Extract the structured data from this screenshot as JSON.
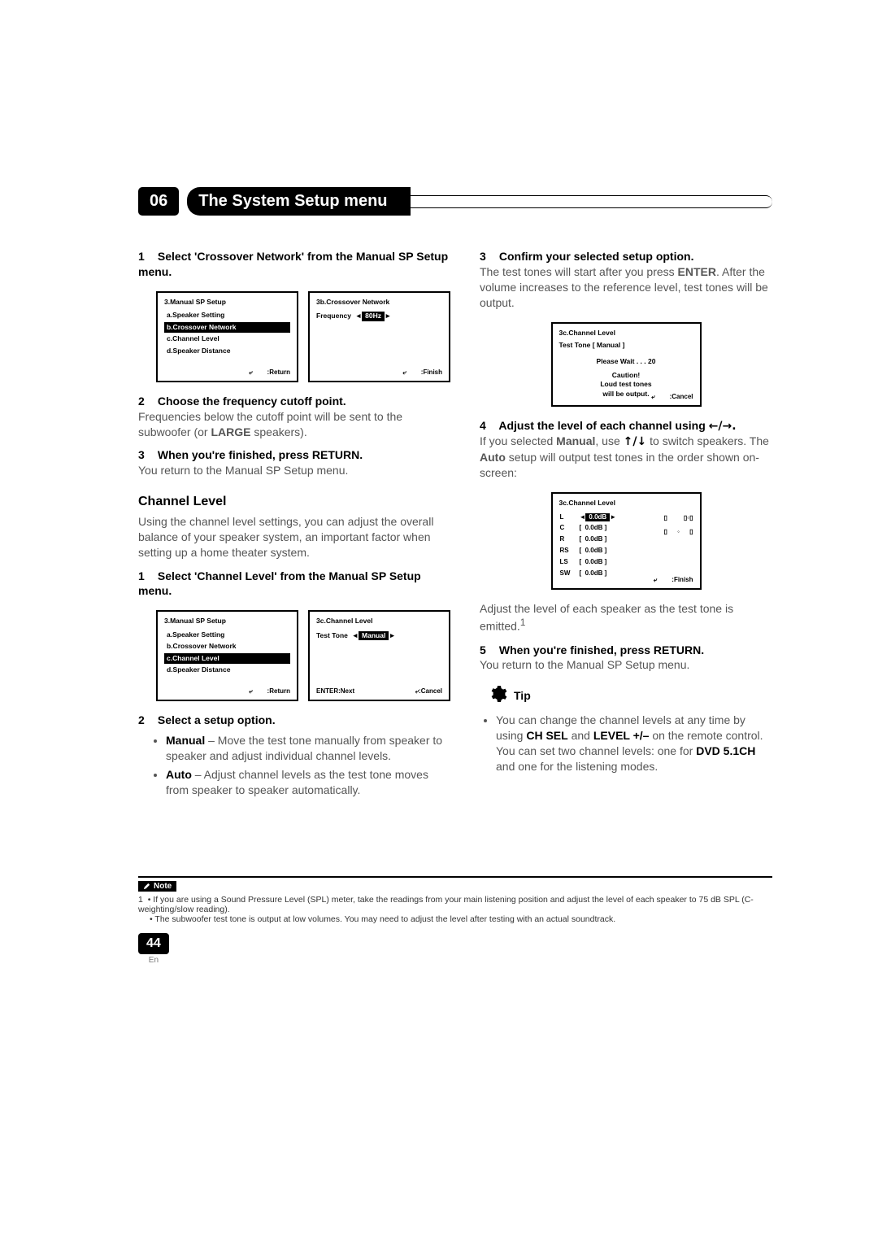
{
  "chapter": {
    "number": "06",
    "title": "The System Setup menu"
  },
  "col_left": {
    "step1": {
      "num": "1",
      "title": "Select 'Crossover Network' from the Manual SP Setup menu."
    },
    "screen_a": {
      "title": "3.Manual  SP   Setup",
      "items": [
        "a.Speaker   Setting",
        "b.Crossover   Network",
        "c.Channel   Level",
        "d.Speaker   Distance"
      ],
      "selected_index": 1,
      "footer_right": ":Return"
    },
    "screen_b": {
      "title": "3b.Crossover   Network",
      "label": "Frequency",
      "value": "80Hz",
      "footer_right": ":Finish"
    },
    "step2": {
      "num": "2",
      "title": "Choose the frequency cutoff point.",
      "body": "Frequencies below the cutoff point will be sent to the subwoofer (or ",
      "bold1": "LARGE",
      "body2": " speakers)."
    },
    "step3": {
      "num": "3",
      "title": "When you're finished, press RETURN.",
      "body": "You return to the Manual SP Setup menu."
    },
    "section": {
      "title": "Channel Level",
      "body": "Using the channel level settings, you can adjust the overall balance of your speaker system, an important factor when setting up a home theater system."
    },
    "step4": {
      "num": "1",
      "title": "Select 'Channel Level' from the Manual SP Setup menu."
    },
    "screen_c": {
      "title": "3.Manual   SP   Setup",
      "items": [
        "a.Speaker   Setting",
        "b.Crossover   Network",
        "c.Channel   Level",
        "d.Speaker   Distance"
      ],
      "selected_index": 2,
      "footer_right": ":Return"
    },
    "screen_d": {
      "title": "3c.Channel   Level",
      "label": "Test   Tone",
      "value": "Manual",
      "footer_left": "ENTER:Next",
      "footer_right": ":Cancel"
    },
    "step5": {
      "num": "2",
      "title": "Select a setup option."
    },
    "bullets": [
      {
        "bold": "Manual",
        "rest": " – Move the test tone manually from speaker to speaker and adjust individual channel levels."
      },
      {
        "bold": "Auto",
        "rest": " – Adjust channel levels as the test tone moves from speaker to speaker automatically."
      }
    ]
  },
  "col_right": {
    "step1": {
      "num": "3",
      "title": "Confirm your selected setup option.",
      "body": "The test tones will start after you press ",
      "bold1": "ENTER",
      "body2": ". After the volume increases to the reference level, test tones will be output."
    },
    "screen_e": {
      "title": "3c.Channel   Level",
      "line1": "Test   Tone       [  Manual  ]",
      "line2": "Please   Wait . . . 20",
      "cautionee": "Caution! ",
      "caution1": "Loud   test   tones",
      "caution2": "will   be   output.",
      "footer_right": ":Cancel"
    },
    "step2": {
      "num": "4",
      "title": "Adjust the level of each channel using ",
      "arrows": "←/→.",
      "body": "If you selected ",
      "bold1": "Manual",
      "body2": ", use ",
      "arrows2": "↑/↓",
      "body3": " to switch speakers. The ",
      "bold2": "Auto",
      "body4": " setup will output test tones in the order shown on-screen:"
    },
    "screen_f": {
      "title": "3c.Channel   Level",
      "rows": [
        {
          "ch": "L",
          "val": "0.0dB",
          "sel": true
        },
        {
          "ch": "C",
          "val": "0.0dB"
        },
        {
          "ch": "R",
          "val": "0.0dB"
        },
        {
          "ch": "RS",
          "val": "0.0dB"
        },
        {
          "ch": "LS",
          "val": "0.0dB"
        },
        {
          "ch": "SW",
          "val": "0.0dB"
        }
      ],
      "footer_right": ":Finish"
    },
    "after_f": "Adjust the level of each speaker as the test tone is emitted.",
    "foot_sup": "1",
    "step3": {
      "num": "5",
      "title": "When you're finished, press RETURN.",
      "body": "You return to the Manual SP Setup menu."
    },
    "tip_label": "Tip",
    "tip_body": "You can change the channel levels at any time by using ",
    "tip_b1": "CH SEL",
    "tip_mid": " and ",
    "tip_b2": "LEVEL +/–",
    "tip_body2": " on the remote control. You can set two channel levels: one for ",
    "tip_b3": "DVD 5.1CH",
    "tip_body3": " and one for the listening modes."
  },
  "note": {
    "label": "Note",
    "line1": "• If you are using a Sound Pressure Level (SPL) meter, take the readings from your main listening position and adjust the level of each speaker to 75 dB SPL (C-weighting/slow reading).",
    "line2": "• The subwoofer test tone is output at low volumes. You may need to adjust the level after testing with an actual soundtrack.",
    "ref": "1"
  },
  "footer": {
    "page": "44",
    "lang": "En"
  }
}
